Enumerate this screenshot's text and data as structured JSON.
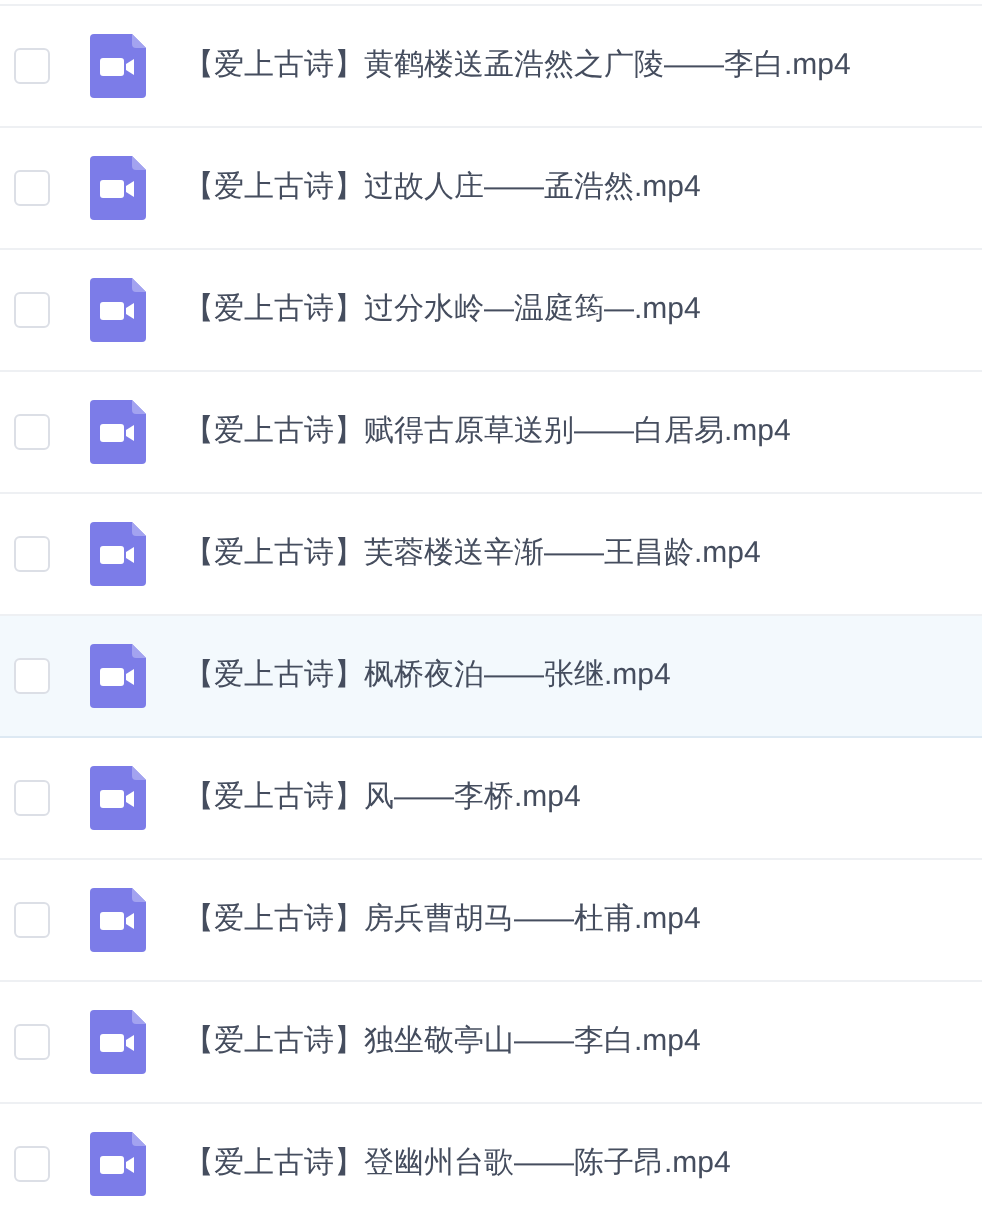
{
  "files": [
    {
      "name": "【爱上古诗】黄鹤楼送孟浩然之广陵——李白.mp4",
      "checked": false,
      "selected": false
    },
    {
      "name": "【爱上古诗】过故人庄——孟浩然.mp4",
      "checked": false,
      "selected": false
    },
    {
      "name": "【爱上古诗】过分水岭—温庭筠—.mp4",
      "checked": false,
      "selected": false
    },
    {
      "name": "【爱上古诗】赋得古原草送别——白居易.mp4",
      "checked": false,
      "selected": false
    },
    {
      "name": "【爱上古诗】芙蓉楼送辛渐——王昌龄.mp4",
      "checked": false,
      "selected": false
    },
    {
      "name": "【爱上古诗】枫桥夜泊——张继.mp4",
      "checked": false,
      "selected": true
    },
    {
      "name": "【爱上古诗】风——李桥.mp4",
      "checked": false,
      "selected": false
    },
    {
      "name": "【爱上古诗】房兵曹胡马——杜甫.mp4",
      "checked": false,
      "selected": false
    },
    {
      "name": "【爱上古诗】独坐敬亭山——李白.mp4",
      "checked": false,
      "selected": false
    },
    {
      "name": "【爱上古诗】登幽州台歌——陈子昂.mp4",
      "checked": false,
      "selected": false
    }
  ]
}
